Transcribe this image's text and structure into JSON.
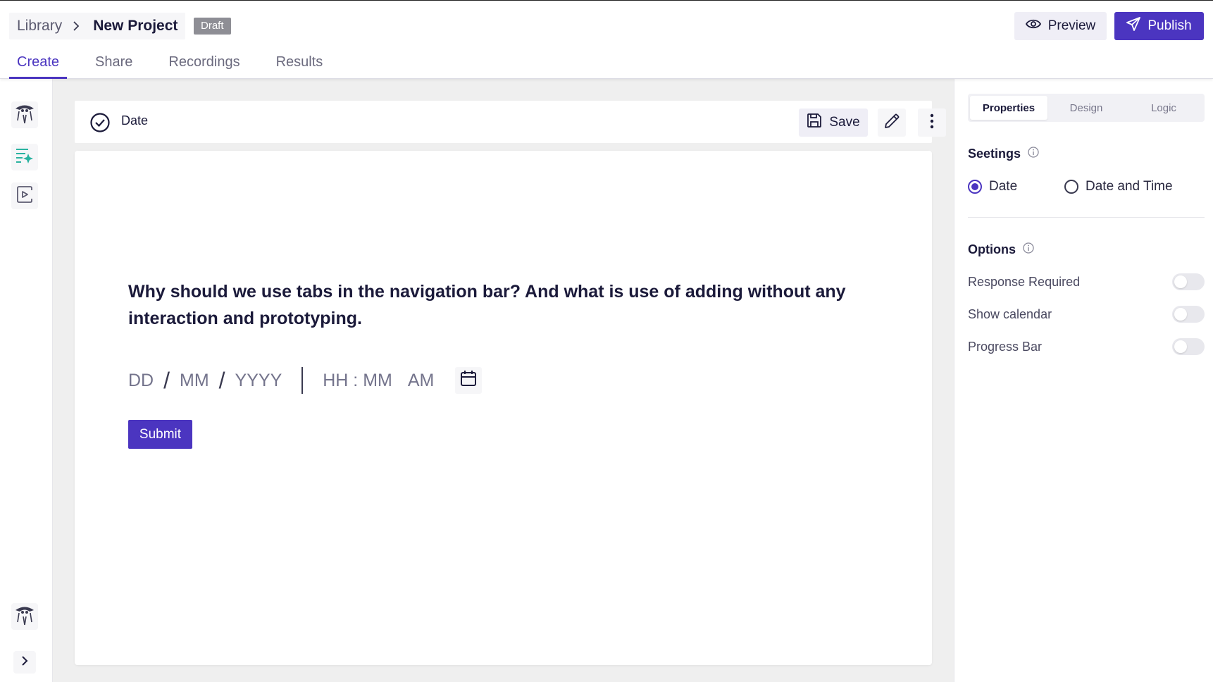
{
  "header": {
    "breadcrumb": {
      "library": "Library",
      "current": "New Project"
    },
    "status_badge": "Draft",
    "preview_label": "Preview",
    "publish_label": "Publish",
    "tabs": [
      {
        "label": "Create",
        "active": true
      },
      {
        "label": "Share",
        "active": false
      },
      {
        "label": "Recordings",
        "active": false
      },
      {
        "label": "Results",
        "active": false
      }
    ]
  },
  "question_bar": {
    "type_label": "Date",
    "save_label": "Save"
  },
  "question": {
    "text": "Why should we use tabs in the navigation bar? And what is use of adding without any interaction and prototyping.",
    "date_input": {
      "day": "DD",
      "month": "MM",
      "year": "YYYY",
      "separator": "/",
      "time": "HH : MM",
      "period": "AM"
    },
    "submit_label": "Submit"
  },
  "panel": {
    "tabs": [
      {
        "label": "Properties",
        "active": true
      },
      {
        "label": "Design",
        "active": false
      },
      {
        "label": "Logic",
        "active": false
      }
    ],
    "settings_title": "Seetings",
    "settings_options": [
      {
        "label": "Date",
        "selected": true
      },
      {
        "label": "Date and Time",
        "selected": false
      }
    ],
    "options_title": "Options",
    "options": [
      {
        "label": "Response Required",
        "enabled": false
      },
      {
        "label": "Show calendar",
        "enabled": false
      },
      {
        "label": "Progress Bar",
        "enabled": false
      }
    ]
  },
  "colors": {
    "accent": "#4b35c0",
    "teal_icon": "#2bb3a0",
    "badge_gray": "#8e8e95"
  },
  "icons": {
    "preview": "eye-icon",
    "publish": "send-icon",
    "question_type": "check-circle-icon",
    "save": "floppy-disk-icon",
    "edit": "pencil-icon",
    "more": "vertical-dots-icon",
    "calendar": "calendar-icon",
    "info": "info-icon",
    "expand": "chevron-right-icon"
  }
}
